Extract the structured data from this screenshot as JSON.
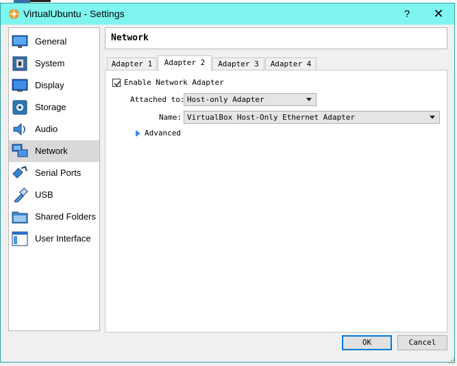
{
  "window": {
    "title": "VirtualUbuntu - Settings",
    "help": "?",
    "close": "✕"
  },
  "sidebar": {
    "items": [
      {
        "label": "General",
        "icon": "general-icon"
      },
      {
        "label": "System",
        "icon": "system-icon"
      },
      {
        "label": "Display",
        "icon": "display-icon"
      },
      {
        "label": "Storage",
        "icon": "storage-icon"
      },
      {
        "label": "Audio",
        "icon": "audio-icon"
      },
      {
        "label": "Network",
        "icon": "network-icon",
        "selected": true
      },
      {
        "label": "Serial Ports",
        "icon": "serial-ports-icon"
      },
      {
        "label": "USB",
        "icon": "usb-icon"
      },
      {
        "label": "Shared Folders",
        "icon": "shared-folders-icon"
      },
      {
        "label": "User Interface",
        "icon": "user-interface-icon"
      }
    ]
  },
  "header": {
    "title": "Network"
  },
  "tabs": [
    {
      "label": "Adapter 1"
    },
    {
      "label": "Adapter 2",
      "active": true
    },
    {
      "label": "Adapter 3"
    },
    {
      "label": "Adapter 4"
    }
  ],
  "adapter": {
    "enable_label": "Enable Network Adapter",
    "enabled": true,
    "attached_label": "Attached to:",
    "attached_value": "Host-only Adapter",
    "name_label": "Name:",
    "name_value": "VirtualBox Host-Only Ethernet Adapter",
    "advanced_label": "Advanced"
  },
  "buttons": {
    "ok": "OK",
    "cancel": "Cancel"
  },
  "colors": {
    "titlebar": "#7ff5ef",
    "selected_item": "#d9d9d9",
    "ok_border": "#0078d7"
  }
}
